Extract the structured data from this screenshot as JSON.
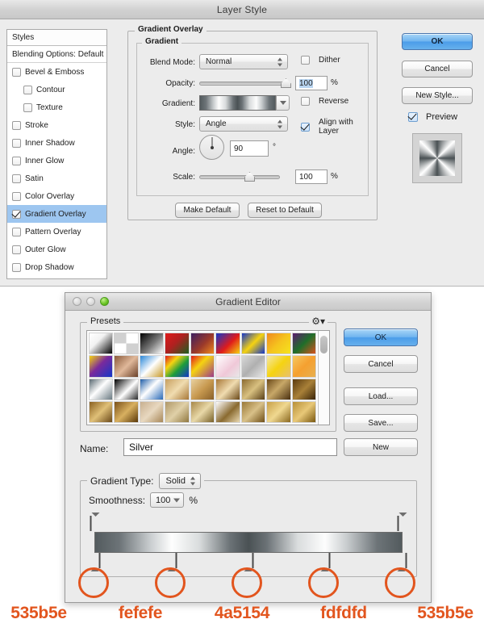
{
  "layer_style": {
    "title": "Layer Style",
    "styles_panel": {
      "header": "Styles",
      "blending_options": "Blending Options: Default",
      "items": [
        {
          "label": "Bevel & Emboss",
          "checked": false,
          "indent": false
        },
        {
          "label": "Contour",
          "checked": false,
          "indent": true
        },
        {
          "label": "Texture",
          "checked": false,
          "indent": true
        },
        {
          "label": "Stroke",
          "checked": false,
          "indent": false
        },
        {
          "label": "Inner Shadow",
          "checked": false,
          "indent": false
        },
        {
          "label": "Inner Glow",
          "checked": false,
          "indent": false
        },
        {
          "label": "Satin",
          "checked": false,
          "indent": false
        },
        {
          "label": "Color Overlay",
          "checked": false,
          "indent": false
        },
        {
          "label": "Gradient Overlay",
          "checked": true,
          "indent": false,
          "selected": true
        },
        {
          "label": "Pattern Overlay",
          "checked": false,
          "indent": false
        },
        {
          "label": "Outer Glow",
          "checked": false,
          "indent": false
        },
        {
          "label": "Drop Shadow",
          "checked": false,
          "indent": false
        }
      ]
    },
    "gradient_overlay": {
      "group_title": "Gradient Overlay",
      "sub_group_title": "Gradient",
      "blend_mode_label": "Blend Mode:",
      "blend_mode_value": "Normal",
      "dither_label": "Dither",
      "dither_checked": false,
      "opacity_label": "Opacity:",
      "opacity_value": "100",
      "opacity_unit": "%",
      "gradient_label": "Gradient:",
      "reverse_label": "Reverse",
      "reverse_checked": false,
      "style_label": "Style:",
      "style_value": "Angle",
      "align_label": "Align with Layer",
      "align_checked": true,
      "angle_label": "Angle:",
      "angle_value": "90",
      "angle_unit": "°",
      "scale_label": "Scale:",
      "scale_value": "100",
      "scale_unit": "%",
      "make_default": "Make Default",
      "reset_to_default": "Reset to Default"
    },
    "buttons": {
      "ok": "OK",
      "cancel": "Cancel",
      "new_style": "New Style...",
      "preview_label": "Preview",
      "preview_checked": true
    }
  },
  "gradient_editor": {
    "title": "Gradient Editor",
    "presets_label": "Presets",
    "gear_icon": "gear-icon",
    "name_label": "Name:",
    "name_value": "Silver",
    "gradient_type_label": "Gradient Type:",
    "gradient_type_value": "Solid",
    "smoothness_label": "Smoothness:",
    "smoothness_value": "100",
    "smoothness_unit": "%",
    "buttons": {
      "ok": "OK",
      "cancel": "Cancel",
      "load": "Load...",
      "save": "Save...",
      "new": "New"
    },
    "preset_swatches": [
      "linear-gradient(135deg,#ffffff 0%,#f2f2f2 38%,#000000 100%)",
      "repeating-conic-gradient(#ffffff 0% 25%,#d0d0d0 0% 50%)",
      "linear-gradient(135deg,#000000 0%,#7a7a7a 55%,#ffffff 100%)",
      "linear-gradient(135deg,#e01b1b 0%,#b02020 45%,#1f5e1f 100%)",
      "linear-gradient(135deg,#3c2060 0%,#9c3a2a 55%,#f08a1e 100%)",
      "linear-gradient(135deg,#1436c8 0%,#e01b1b 55%,#f5d311 100%)",
      "linear-gradient(135deg,#1436c8 0%,#f5d311 50%,#1436c8 100%)",
      "linear-gradient(135deg,#f08a1e 0%,#f5c31e 50%,#f5e31e 100%)",
      "linear-gradient(135deg,#5a1a6e 0%,#1f6e2a 50%,#d8521e 100%)",
      "linear-gradient(135deg,#f5d311 0%,#7a2a9c 45%,#1436c8 100%)",
      "linear-gradient(135deg,#8a5a3a 0%,#e0b89a 50%,#6a4028 100%)",
      "linear-gradient(135deg,#2a86d8 0%,#ffffff 50%,#c89a28 100%)",
      "linear-gradient(135deg,#e01b1b 0%,#f5d311 30%,#1f9c3a 60%,#1436c8 100%)",
      "linear-gradient(135deg,#e01b1b 0%,#f5d311 40%,#9c3a8a 100%)",
      "linear-gradient(135deg,#ffffff 0%,#f0c8d8 60%,#e8e8e8 100%)",
      "linear-gradient(135deg,#d8d8d8 0%,#b0b0b0 50%,#e8e8e8 100%)",
      "linear-gradient(135deg,#f5e8a8 0%,#f5d311 50%,#e8c070 100%)",
      "linear-gradient(135deg,#f5c860 0%,#f5a030 50%,#e8b050 100%)",
      "linear-gradient(135deg,#5a6a72 0%,#ffffff 45%,#6a7a82 100%)",
      "linear-gradient(135deg,#000000 0%,#ffffff 55%,#2a2a2a 100%)",
      "linear-gradient(135deg,#1f5ea8 0%,#ffffff 45%,#2a6ab8 100%)",
      "linear-gradient(135deg,#c8a060 0%,#f0dcb0 50%,#a87838 100%)",
      "linear-gradient(135deg,#e8d0a0 0%,#c89a50 50%,#8a6028 100%)",
      "linear-gradient(135deg,#a87838 0%,#f0dcb0 50%,#6a4818 100%)",
      "linear-gradient(135deg,#8a6a30 0%,#d8c080 50%,#5a4018 100%)",
      "linear-gradient(135deg,#6a4818 0%,#c8a868 45%,#4a3010 100%)",
      "linear-gradient(135deg,#5a3a10 0%,#a88038 50%,#3a2408 100%)",
      "linear-gradient(135deg,#8a6020 0%,#e0c078 50%,#6a4818 100%)",
      "linear-gradient(135deg,#7a5018 0%,#d8b060 50%,#5a3808 100%)",
      "linear-gradient(135deg,#c8b090 0%,#e8d8c0 50%,#a88858 100%)",
      "linear-gradient(135deg,#b09868 0%,#e0d0a8 50%,#907840 100%)",
      "linear-gradient(135deg,#a88848 0%,#e8d8a8 50%,#786028 100%)",
      "linear-gradient(135deg,#ffffff 0%,#8a6a30 55%,#e8d8b0 100%)",
      "linear-gradient(135deg,#9a7838 0%,#d8c088 50%,#705018 100%)",
      "linear-gradient(135deg,#c8a048 0%,#f0d890 50%,#8a6820 100%)",
      "linear-gradient(135deg,#b89038 0%,#e8c878 50%,#7a5810 100%)"
    ],
    "gradient_stops": {
      "top_stops": [
        {
          "position_pct": 0,
          "color": "#1e1e1e",
          "opacity": "100%"
        },
        {
          "position_pct": 100,
          "color": "#1e1e1e",
          "opacity": "100%"
        }
      ],
      "bottom_stops": [
        {
          "position_pct": 0,
          "color": "#535b5e",
          "hex_label": "535b5e"
        },
        {
          "position_pct": 25,
          "color": "#fefefe",
          "hex_label": "fefefe"
        },
        {
          "position_pct": 50,
          "color": "#4a5154",
          "hex_label": "4a5154"
        },
        {
          "position_pct": 75,
          "color": "#fdfdfd",
          "hex_label": "fdfdfd"
        },
        {
          "position_pct": 100,
          "color": "#535b5e",
          "hex_label": "535b5e"
        }
      ]
    }
  },
  "annotations": {
    "hex_labels": [
      "535b5e",
      "fefefe",
      "4a5154",
      "fdfdfd",
      "535b5e"
    ],
    "highlight_color": "#e2551e"
  }
}
